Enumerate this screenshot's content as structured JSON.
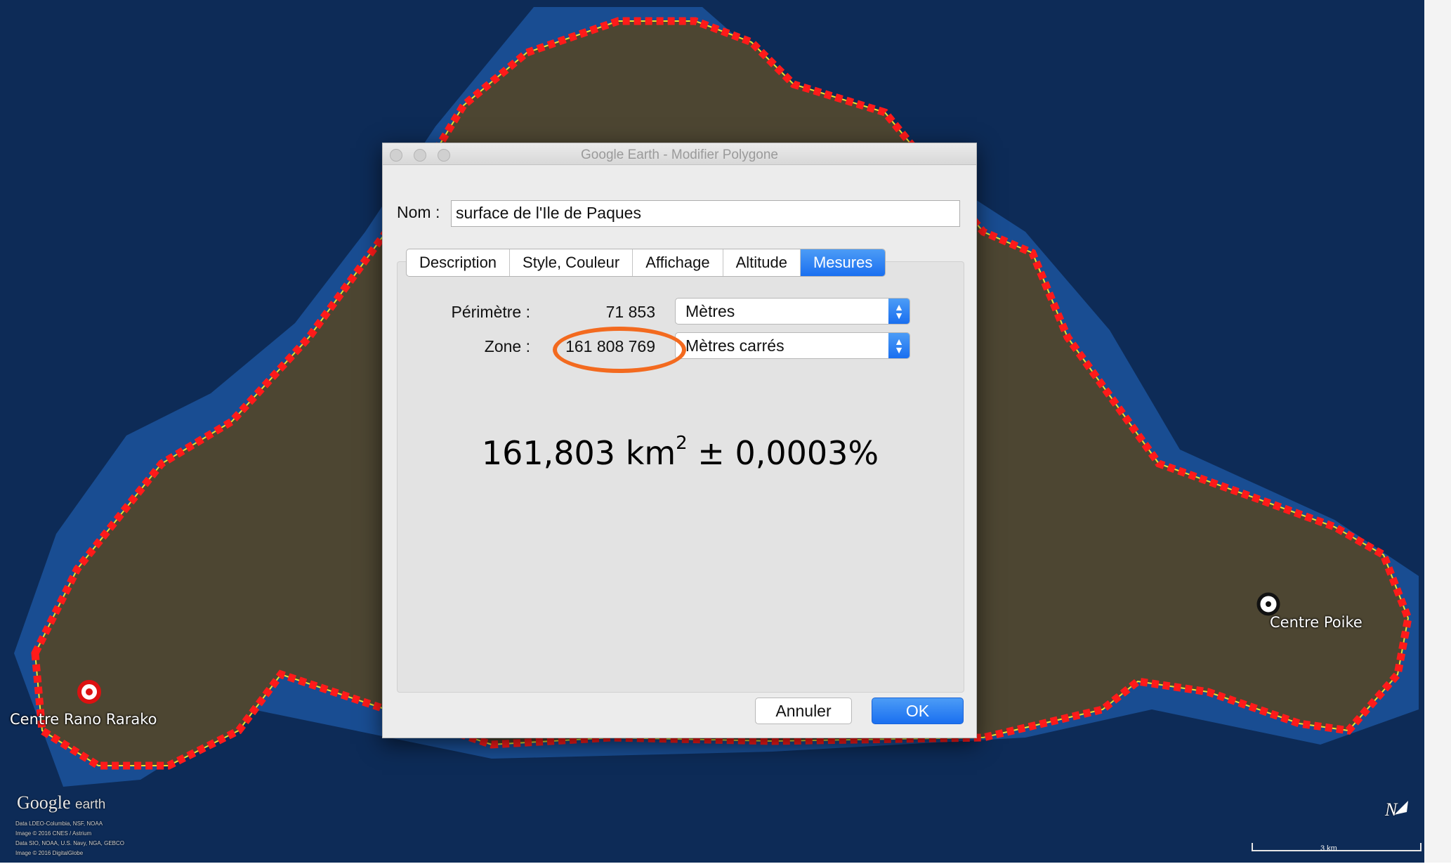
{
  "map": {
    "place_labels": {
      "rano_raraku": "Centre Rano Rarako",
      "poike": "Centre Poike"
    },
    "logo": {
      "brand": "Google",
      "product": "earth"
    },
    "credits": [
      "Data LDEO-Columbia, NSF, NOAA",
      "Image © 2016 CNES / Astrium",
      "Data SIO, NOAA, U.S. Navy, NGA, GEBCO",
      "Image © 2016 DigitalGlobe"
    ],
    "scale_label": "3 km",
    "north_label": "N",
    "colors": {
      "polygon_outline": "#ff1a1a",
      "edge_line": "#e6e62e",
      "ocean": "#0d3a72",
      "land": "#4a4330"
    }
  },
  "dialog": {
    "title": "Google Earth - Modifier Polygone",
    "name_label": "Nom :",
    "name_value": "surface de l'Ile de Paques",
    "tabs": [
      {
        "label": "Description",
        "active": false
      },
      {
        "label": "Style, Couleur",
        "active": false
      },
      {
        "label": "Affichage",
        "active": false
      },
      {
        "label": "Altitude",
        "active": false
      },
      {
        "label": "Mesures",
        "active": true
      }
    ],
    "perimeter": {
      "label": "Périmètre :",
      "value": "71 853",
      "unit": "Mètres"
    },
    "zone": {
      "label": "Zone :",
      "value": "161 808 769",
      "unit": "Mètres carrés"
    },
    "annotation": {
      "main": "161,803 km",
      "exponent": "2",
      "rest": " ± 0,0003%"
    },
    "buttons": {
      "cancel": "Annuler",
      "ok": "OK"
    },
    "accent_color": "#1a6ff0",
    "highlight_color": "#f36a1f"
  }
}
